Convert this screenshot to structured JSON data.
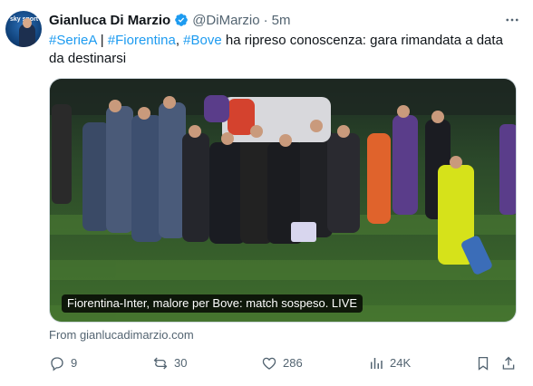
{
  "tweet": {
    "author_name": "Gianluca Di Marzio",
    "handle": "@DiMarzio",
    "separator": "·",
    "time": "5m",
    "text_parts": {
      "tag1": "#SerieA",
      "sep1": " | ",
      "tag2": "#Fiorentina",
      "sep2": ", ",
      "tag3": "#Bove",
      "rest": " ha ripreso conoscenza: gara rimandata a data da destinarsi"
    },
    "media_caption": "Fiorentina-Inter, malore per Bove: match sospeso. LIVE",
    "source": "From gianlucadimarzio.com",
    "avatar_text": "sky sport"
  },
  "actions": {
    "replies": "9",
    "reposts": "30",
    "likes": "286",
    "views": "24K"
  },
  "icons": [
    "verified-badge-icon",
    "more-icon",
    "reply-icon",
    "repost-icon",
    "like-icon",
    "views-icon",
    "bookmark-icon",
    "share-icon"
  ],
  "colors": {
    "link": "#1d9bf0",
    "muted": "#536471",
    "verified": "#1d9bf0"
  }
}
